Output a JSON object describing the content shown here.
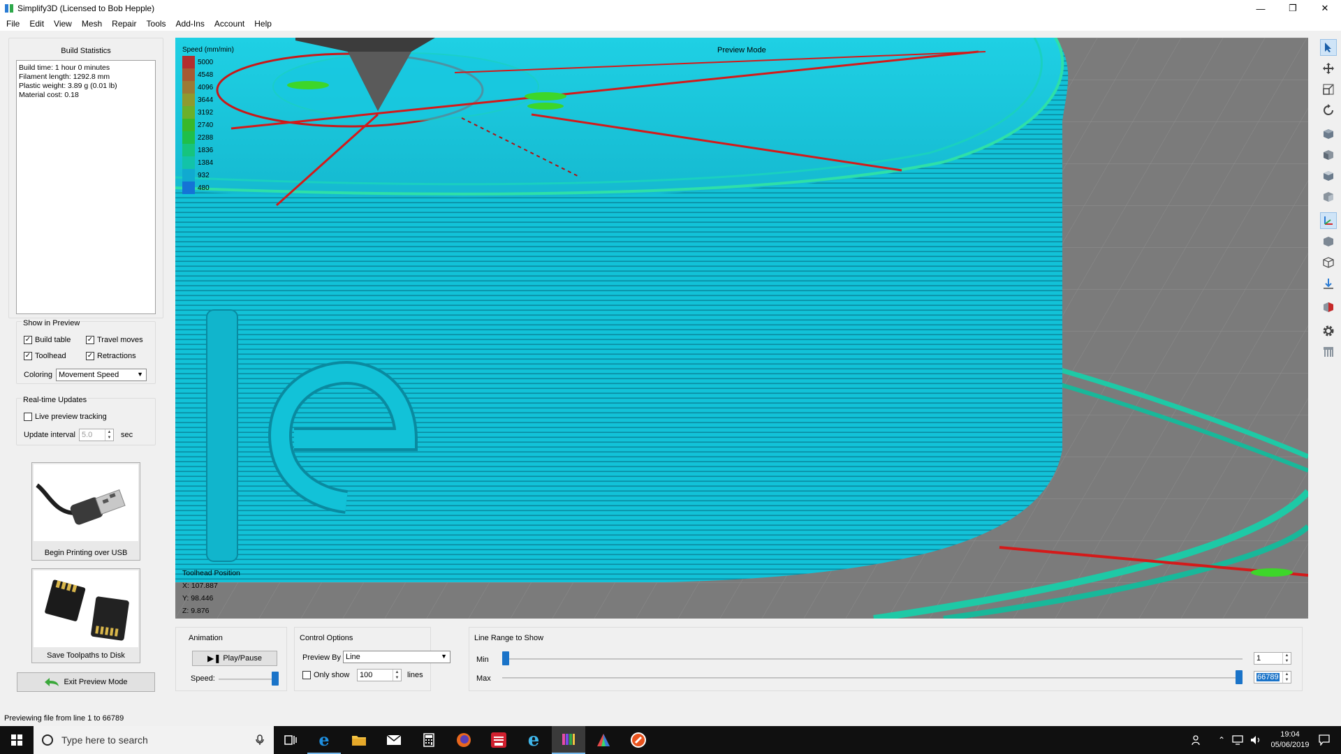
{
  "window": {
    "title": "Simplify3D (Licensed to Bob Hepple)",
    "minimize_glyph": "—",
    "maximize_glyph": "❐",
    "close_glyph": "✕"
  },
  "menu": [
    "File",
    "Edit",
    "View",
    "Mesh",
    "Repair",
    "Tools",
    "Add-Ins",
    "Account",
    "Help"
  ],
  "build_statistics": {
    "title": "Build Statistics",
    "lines": [
      "Build time: 1 hour 0 minutes",
      "Filament length: 1292.8 mm",
      "Plastic weight: 3.89 g (0.01 lb)",
      "Material cost: 0.18"
    ]
  },
  "show_in_preview": {
    "title": "Show in Preview",
    "build_table": {
      "label": "Build table",
      "checked": true
    },
    "travel_moves": {
      "label": "Travel moves",
      "checked": true
    },
    "toolhead": {
      "label": "Toolhead",
      "checked": true
    },
    "retractions": {
      "label": "Retractions",
      "checked": true
    },
    "coloring_label": "Coloring",
    "coloring_value": "Movement Speed"
  },
  "realtime_updates": {
    "title": "Real-time Updates",
    "live_preview": {
      "label": "Live preview tracking",
      "checked": false
    },
    "interval_label": "Update interval",
    "interval_value": "5.0",
    "interval_unit": "sec"
  },
  "actions": {
    "usb_label": "Begin Printing over USB",
    "sd_label": "Save Toolpaths to Disk",
    "exit_label": "Exit Preview Mode"
  },
  "viewport": {
    "legend_title": "Speed (mm/min)",
    "legend": [
      {
        "value": "5000",
        "color": "#b22e2e"
      },
      {
        "value": "4548",
        "color": "#a65a32"
      },
      {
        "value": "4096",
        "color": "#9c7a34"
      },
      {
        "value": "3644",
        "color": "#8f9a2e"
      },
      {
        "value": "3192",
        "color": "#6bb02a"
      },
      {
        "value": "2740",
        "color": "#39b82a"
      },
      {
        "value": "2288",
        "color": "#1fbf4a"
      },
      {
        "value": "1836",
        "color": "#16c47e"
      },
      {
        "value": "1384",
        "color": "#12c3a8"
      },
      {
        "value": "932",
        "color": "#10aad0"
      },
      {
        "value": "480",
        "color": "#1473d6"
      }
    ],
    "mode_label": "Preview Mode",
    "toolhead_title": "Toolhead Position",
    "x": "X: 107.887",
    "y": "Y: 98.446",
    "z": "Z: 9.876"
  },
  "animation": {
    "title": "Animation",
    "play_label": "Play/Pause",
    "speed_label": "Speed:",
    "speed_level": 1.0
  },
  "control_options": {
    "title": "Control Options",
    "preview_by_label": "Preview By",
    "preview_by_value": "Line",
    "only_show_label": "Only show",
    "only_show_checked": false,
    "only_show_value": "100",
    "only_show_unit": "lines"
  },
  "line_range": {
    "title": "Line Range to Show",
    "min_label": "Min",
    "max_label": "Max",
    "min_value": "1",
    "max_value": "66789",
    "min_level": 0.0,
    "max_level": 1.0
  },
  "status": "Previewing file from line 1 to 66789",
  "taskbar": {
    "search_placeholder": "Type here to search",
    "time": "19:04",
    "date": "05/06/2019"
  },
  "colors": {
    "print_cyan": "#14c6dc",
    "travel_red": "#d41a1a",
    "selection_blue": "#1a73c8"
  }
}
